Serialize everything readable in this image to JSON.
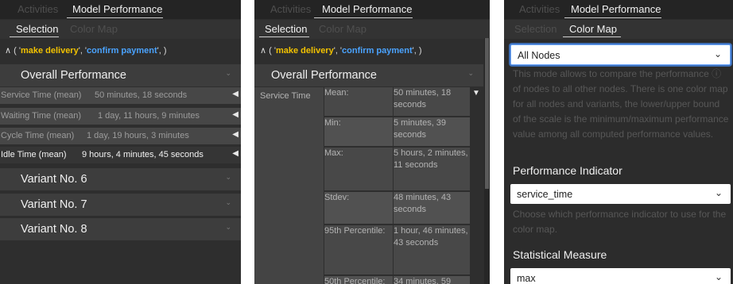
{
  "tabs": {
    "activities": "Activities",
    "model_performance": "Model Performance",
    "selection": "Selection",
    "color_map": "Color Map"
  },
  "sequence": {
    "prefix": "∧ ( '",
    "act1": "make delivery",
    "sep": "', '",
    "act2": "confirm payment",
    "suffix": "', )"
  },
  "panel1": {
    "overall": "Overall Performance",
    "metrics": [
      {
        "label": "Service Time (mean)",
        "value": "50 minutes, 18 seconds"
      },
      {
        "label": "Waiting Time (mean)",
        "value": "1 day, 11 hours, 9 minutes"
      },
      {
        "label": "Cycle Time (mean)",
        "value": "1 day, 19 hours, 3 minutes"
      },
      {
        "label": "Idle Time (mean)",
        "value": "9 hours, 4 minutes, 45 seconds"
      }
    ],
    "variants": [
      "Variant No. 6",
      "Variant No. 7",
      "Variant No. 8"
    ]
  },
  "panel2": {
    "overall": "Overall Performance",
    "metric_name": "Service Time",
    "stats": [
      {
        "label": "Mean:",
        "value": "50 minutes, 18 seconds"
      },
      {
        "label": "Min:",
        "value": "5 minutes, 39 seconds"
      },
      {
        "label": "Max:",
        "value": "5 hours, 2 minutes, 11 seconds"
      },
      {
        "label": "Stdev:",
        "value": "48 minutes, 43 seconds"
      },
      {
        "label": "95th Percentile:",
        "value": "1 hour, 46 minutes, 43 seconds"
      },
      {
        "label": "50th Percentile:",
        "value": "34 minutes, 59"
      }
    ]
  },
  "panel3": {
    "mode_select": "All Nodes",
    "mode_help": "This mode allows to compare the performance ⓘ of nodes to all other nodes. There is one color map for all nodes and variants, the lower/upper bound of the scale is the minimum/maximum performance value among all computed performance values.",
    "indicator_title": "Performance Indicator",
    "indicator_select": "service_time",
    "indicator_help": "Choose which performance indicator to use for the color map.",
    "measure_title": "Statistical Measure",
    "measure_select": "max"
  }
}
